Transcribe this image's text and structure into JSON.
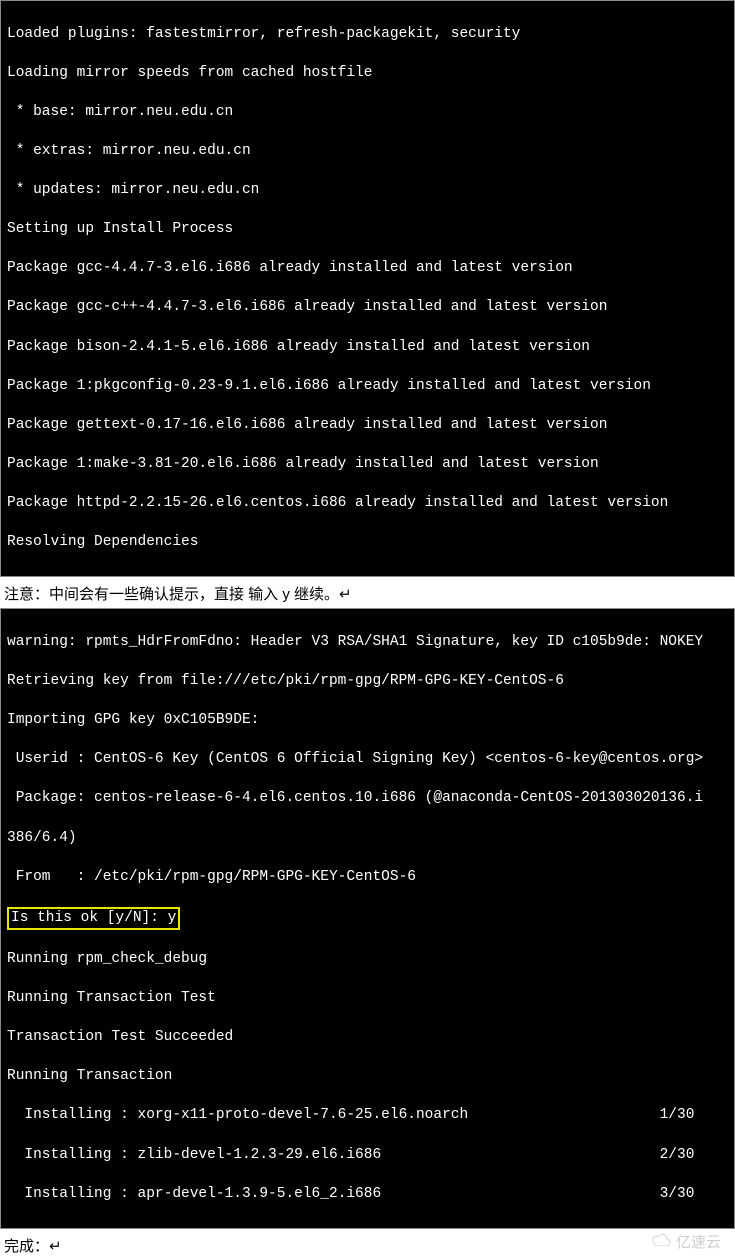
{
  "terminal1": {
    "lines": [
      "Loaded plugins: fastestmirror, refresh-packagekit, security",
      "Loading mirror speeds from cached hostfile",
      " * base: mirror.neu.edu.cn",
      " * extras: mirror.neu.edu.cn",
      " * updates: mirror.neu.edu.cn",
      "Setting up Install Process",
      "Package gcc-4.4.7-3.el6.i686 already installed and latest version",
      "Package gcc-c++-4.4.7-3.el6.i686 already installed and latest version",
      "Package bison-2.4.1-5.el6.i686 already installed and latest version",
      "Package 1:pkgconfig-0.23-9.1.el6.i686 already installed and latest version",
      "Package gettext-0.17-16.el6.i686 already installed and latest version",
      "Package 1:make-3.81-20.el6.i686 already installed and latest version",
      "Package httpd-2.2.15-26.el6.centos.i686 already installed and latest version",
      "Resolving Dependencies"
    ]
  },
  "caption1": "注意：中间会有一些确认提示，直接  输入 y 继续。↵",
  "terminal2": {
    "lines_before_prompt": [
      "warning: rpmts_HdrFromFdno: Header V3 RSA/SHA1 Signature, key ID c105b9de: NOKEY",
      "Retrieving key from file:///etc/pki/rpm-gpg/RPM-GPG-KEY-CentOS-6",
      "Importing GPG key 0xC105B9DE:",
      " Userid : CentOS-6 Key (CentOS 6 Official Signing Key) <centos-6-key@centos.org>",
      " Package: centos-release-6-4.el6.centos.10.i686 (@anaconda-CentOS-201303020136.i",
      "386/6.4)",
      " From   : /etc/pki/rpm-gpg/RPM-GPG-KEY-CentOS-6"
    ],
    "prompt_line": "Is this ok [y/N]: y",
    "lines_after_prompt": [
      "Running rpm_check_debug",
      "Running Transaction Test",
      "Transaction Test Succeeded",
      "Running Transaction",
      "  Installing : xorg-x11-proto-devel-7.6-25.el6.noarch                      1/30",
      "  Installing : zlib-devel-1.2.3-29.el6.i686                                2/30",
      "  Installing : apr-devel-1.3.9-5.el6_2.i686                                3/30"
    ]
  },
  "caption2": "完成：↵",
  "watermark": "亿速云"
}
